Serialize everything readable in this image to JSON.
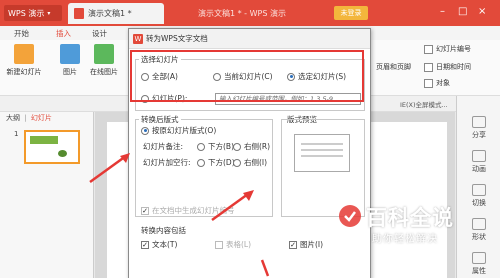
{
  "titlebar": {
    "app_button": "WPS 演示",
    "doc_tab": "演示文稿1 *",
    "app_title": "演示文稿1 * - WPS 演示",
    "login_button": "未登录"
  },
  "menu": {
    "items": [
      "开始",
      "插入",
      "设计"
    ],
    "active_index": 1
  },
  "ribbon": {
    "buttons": [
      "新建幻灯片",
      "图片",
      "在线图片"
    ],
    "right_items": [
      "幻灯片编号",
      "页眉和页脚",
      "日期和时间"
    ],
    "extra_items": [
      "对象"
    ]
  },
  "left_panel": {
    "tabs": [
      "大纲",
      "幻灯片"
    ],
    "active_tab": 1,
    "slide_number": "1"
  },
  "right_panel": {
    "items": [
      "分享",
      "动画",
      "切换",
      "形状",
      "属性"
    ]
  },
  "toolbar2": {
    "mode_label": "IE(X)全屏模式..."
  },
  "dialog": {
    "title": "转为WPS文字文档",
    "select_slides": {
      "label": "选择幻灯片",
      "options": [
        "全部(A)",
        "当前幻灯片(C)",
        "选定幻灯片(S)"
      ],
      "selected_index": 2,
      "slides_option": "幻灯片(P):",
      "slides_placeholder": "输入幻灯片编号或范围，例如：1,3,5-9"
    },
    "layout": {
      "label": "转换后版式",
      "keep_layout": "按原幻灯片版式(O)",
      "notes_label": "幻灯片备注:",
      "notes_options": [
        "下方(B)",
        "右侧(R)"
      ],
      "blank_label": "幻灯片加空行:",
      "blank_options": [
        "下方(D)",
        "右侧(I)"
      ],
      "outline_check": "在文档中生成幻灯片编号"
    },
    "preview": {
      "label": "版式预览"
    },
    "content": {
      "label": "转换内容包括",
      "items": [
        "文本(T)",
        "表格(L)",
        "图片(I)"
      ],
      "checked": [
        true,
        false,
        true
      ],
      "disabled": [
        false,
        true,
        false
      ]
    }
  },
  "watermark": {
    "brand": "百科全说",
    "slogan": "助你轻松解决"
  },
  "colors": {
    "accent": "#e24a3a",
    "highlight": "#e53935",
    "active_tab": "#e24a3a"
  }
}
